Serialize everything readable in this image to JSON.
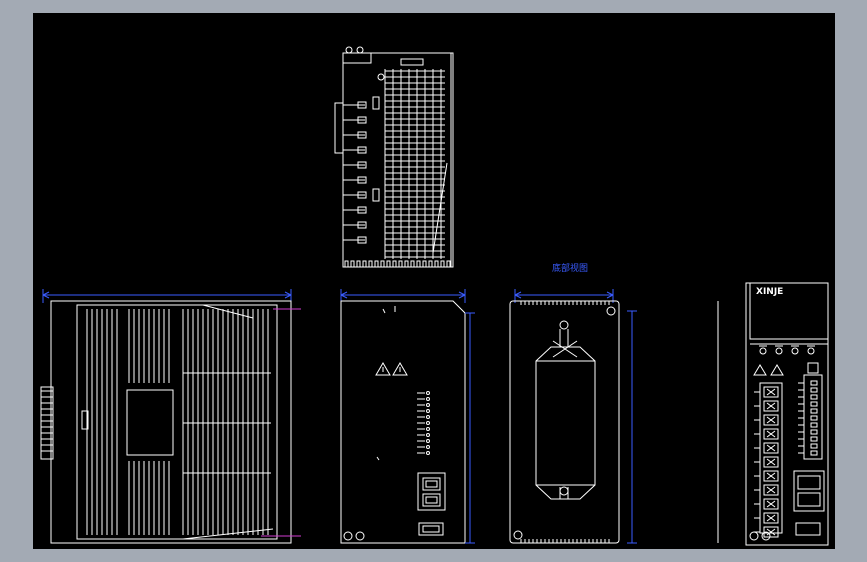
{
  "drawing": {
    "background_color": "#000000",
    "frame_color": "#a3aab4",
    "line_color": "#ffffff",
    "dimension_color": "#3a5cff",
    "center_mark_color": "#d13cd1"
  },
  "labels": {
    "bottom_view_title": "底部视图",
    "front_brand": "XINJE"
  },
  "icons": [
    "warning-triangle-icon",
    "rj45-port-icon",
    "screw-terminal-icon"
  ]
}
